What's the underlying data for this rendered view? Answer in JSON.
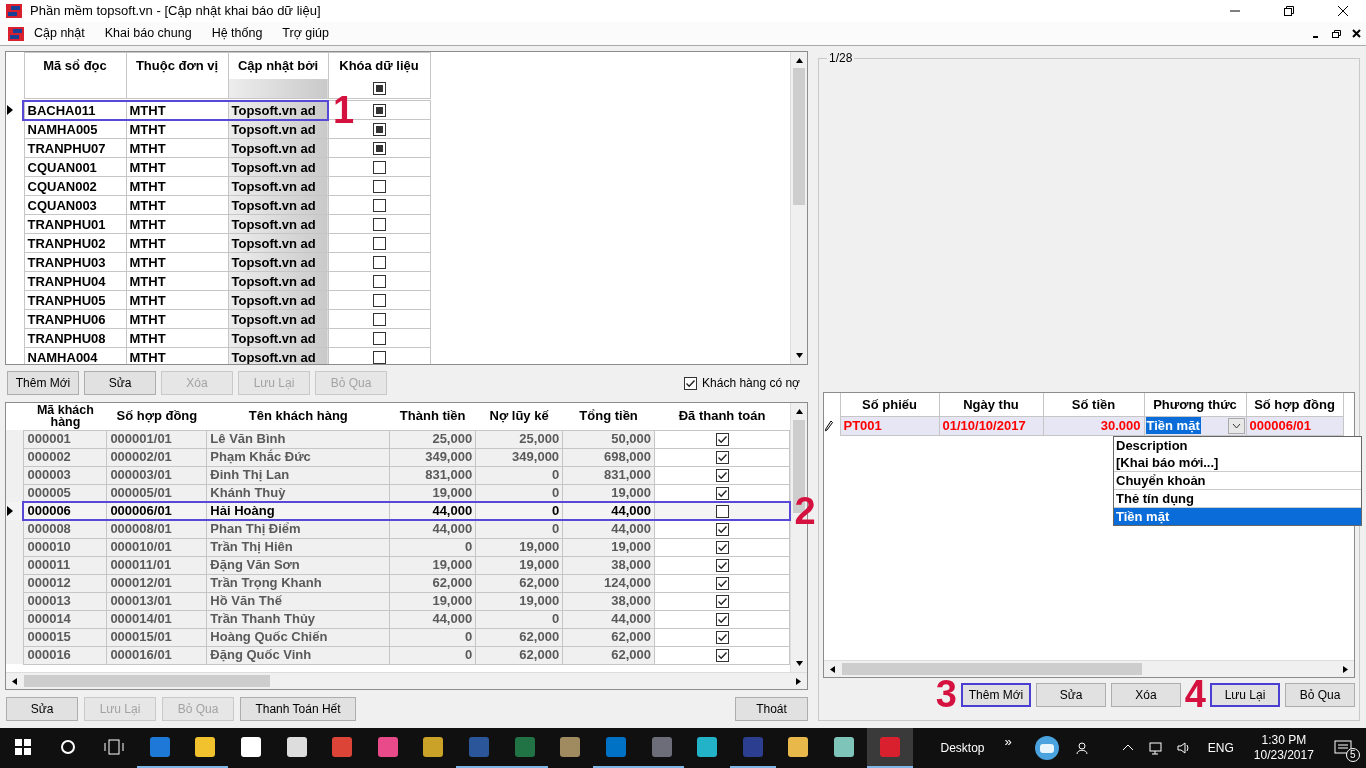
{
  "window": {
    "title": "Phần mềm topsoft.vn - [Cập nhật khai báo dữ liệu]"
  },
  "menu": [
    "Cập nhật",
    "Khai báo chung",
    "Hệ thống",
    "Trợ giúp"
  ],
  "reader_grid": {
    "columns": [
      "Mã sổ đọc",
      "Thuộc đơn vị",
      "Cập nhật bởi",
      "Khóa dữ liệu"
    ],
    "header_lock_checked": true,
    "rows": [
      {
        "code": "BACHA011",
        "unit": "MTHT",
        "updated_by": "Topsoft.vn ad",
        "locked": true,
        "current": true,
        "callout": "1"
      },
      {
        "code": "NAMHA005",
        "unit": "MTHT",
        "updated_by": "Topsoft.vn ad",
        "locked": true,
        "current": false
      },
      {
        "code": "TRANPHU07",
        "unit": "MTHT",
        "updated_by": "Topsoft.vn ad",
        "locked": true,
        "current": false
      },
      {
        "code": "CQUAN001",
        "unit": "MTHT",
        "updated_by": "Topsoft.vn ad",
        "locked": false,
        "current": false
      },
      {
        "code": "CQUAN002",
        "unit": "MTHT",
        "updated_by": "Topsoft.vn ad",
        "locked": false,
        "current": false
      },
      {
        "code": "CQUAN003",
        "unit": "MTHT",
        "updated_by": "Topsoft.vn ad",
        "locked": false,
        "current": false
      },
      {
        "code": "TRANPHU01",
        "unit": "MTHT",
        "updated_by": "Topsoft.vn ad",
        "locked": false,
        "current": false
      },
      {
        "code": "TRANPHU02",
        "unit": "MTHT",
        "updated_by": "Topsoft.vn ad",
        "locked": false,
        "current": false
      },
      {
        "code": "TRANPHU03",
        "unit": "MTHT",
        "updated_by": "Topsoft.vn ad",
        "locked": false,
        "current": false
      },
      {
        "code": "TRANPHU04",
        "unit": "MTHT",
        "updated_by": "Topsoft.vn ad",
        "locked": false,
        "current": false
      },
      {
        "code": "TRANPHU05",
        "unit": "MTHT",
        "updated_by": "Topsoft.vn ad",
        "locked": false,
        "current": false
      },
      {
        "code": "TRANPHU06",
        "unit": "MTHT",
        "updated_by": "Topsoft.vn ad",
        "locked": false,
        "current": false
      },
      {
        "code": "TRANPHU08",
        "unit": "MTHT",
        "updated_by": "Topsoft.vn ad",
        "locked": false,
        "current": false
      },
      {
        "code": "NAMHA004",
        "unit": "MTHT",
        "updated_by": "Topsoft.vn ad",
        "locked": false,
        "current": false
      }
    ]
  },
  "top_buttons": [
    {
      "label": "Thêm Mới",
      "disabled": false
    },
    {
      "label": "Sửa",
      "disabled": false
    },
    {
      "label": "Xóa",
      "disabled": true
    },
    {
      "label": "Lưu Lại",
      "disabled": true
    },
    {
      "label": "Bỏ Qua",
      "disabled": true
    }
  ],
  "debt_filter": {
    "label": "Khách hàng có nợ",
    "checked": true
  },
  "customer_grid": {
    "columns": [
      "Mã khách hàng",
      "Số hợp đồng",
      "Tên khách hàng",
      "Thành tiền",
      "Nợ lũy kế",
      "Tổng tiền",
      "Đã thanh toán"
    ],
    "rows": [
      {
        "cells": [
          "000001",
          "000001/01",
          "Lê Văn Bình",
          "25,000",
          "25,000",
          "50,000"
        ],
        "paid": true,
        "current": false
      },
      {
        "cells": [
          "000002",
          "000002/01",
          "Phạm Khắc Đức",
          "349,000",
          "349,000",
          "698,000"
        ],
        "paid": true,
        "current": false
      },
      {
        "cells": [
          "000003",
          "000003/01",
          "Đinh Thị Lan",
          "831,000",
          "0",
          "831,000"
        ],
        "paid": true,
        "current": false
      },
      {
        "cells": [
          "000005",
          "000005/01",
          "Khánh Thuỳ",
          "19,000",
          "0",
          "19,000"
        ],
        "paid": true,
        "current": false
      },
      {
        "cells": [
          "000006",
          "000006/01",
          "Hải Hoàng",
          "44,000",
          "0",
          "44,000"
        ],
        "paid": false,
        "current": true,
        "callout": "2"
      },
      {
        "cells": [
          "000008",
          "000008/01",
          "Phan Thị Điểm",
          "44,000",
          "0",
          "44,000"
        ],
        "paid": true,
        "current": false
      },
      {
        "cells": [
          "000010",
          "000010/01",
          "Trần Thị Hiên",
          "0",
          "19,000",
          "19,000"
        ],
        "paid": true,
        "current": false
      },
      {
        "cells": [
          "000011",
          "000011/01",
          "Đặng Văn Sơn",
          "19,000",
          "19,000",
          "38,000"
        ],
        "paid": true,
        "current": false
      },
      {
        "cells": [
          "000012",
          "000012/01",
          "Trần Trọng Khanh",
          "62,000",
          "62,000",
          "124,000"
        ],
        "paid": true,
        "current": false
      },
      {
        "cells": [
          "000013",
          "000013/01",
          "Hồ Văn Thế",
          "19,000",
          "19,000",
          "38,000"
        ],
        "paid": true,
        "current": false
      },
      {
        "cells": [
          "000014",
          "000014/01",
          "Trần Thanh Thủy",
          "44,000",
          "0",
          "44,000"
        ],
        "paid": true,
        "current": false
      },
      {
        "cells": [
          "000015",
          "000015/01",
          "Hoàng Quốc Chiến",
          "0",
          "62,000",
          "62,000"
        ],
        "paid": true,
        "current": false
      },
      {
        "cells": [
          "000016",
          "000016/01",
          "Đặng Quốc Vinh",
          "0",
          "62,000",
          "62,000"
        ],
        "paid": true,
        "current": false
      }
    ]
  },
  "bottom_buttons": [
    {
      "label": "Sửa",
      "disabled": false
    },
    {
      "label": "Lưu Lại",
      "disabled": true
    },
    {
      "label": "Bỏ Qua",
      "disabled": true
    },
    {
      "label": "Thanh Toán Hết",
      "disabled": false
    }
  ],
  "exit_button": "Thoát",
  "receipt_panel": {
    "record_counter": "1/28",
    "columns": [
      "Số phiếu",
      "Ngày thu",
      "Số tiền",
      "Phương thức",
      "Số hợp đồng"
    ],
    "rows": [
      {
        "number": "PT001",
        "date": "01/10/10/2017",
        "amount": "30.000",
        "method": "Tiền mặt",
        "contract": "000006/01",
        "editing": true
      }
    ],
    "method_dropdown": {
      "header": "Description",
      "options": [
        {
          "label": "[Khai báo mới...]",
          "selected": false
        },
        {
          "label": "Chuyển khoản",
          "selected": false
        },
        {
          "label": "Thẻ tín dụng",
          "selected": false
        },
        {
          "label": "Tiền mặt",
          "selected": true
        }
      ]
    },
    "buttons": [
      {
        "label": "Thêm Mới",
        "callout": "3"
      },
      {
        "label": "Sửa"
      },
      {
        "label": "Xóa"
      },
      {
        "label": "Lưu Lại",
        "callout": "4"
      },
      {
        "label": "Bỏ Qua"
      }
    ]
  },
  "taskbar": {
    "apps": [
      {
        "color": "#1e78d7",
        "open": true,
        "selected": false
      },
      {
        "color": "#f2c12e",
        "open": true,
        "selected": false
      },
      {
        "color": "#ffffff",
        "open": false,
        "selected": false
      },
      {
        "color": "#dddddd",
        "open": false,
        "selected": false
      },
      {
        "color": "#db4437",
        "open": false,
        "selected": false
      },
      {
        "color": "#e84a8a",
        "open": false,
        "selected": false
      },
      {
        "color": "#c9a227",
        "open": false,
        "selected": false
      },
      {
        "color": "#2b579a",
        "open": true,
        "selected": false
      },
      {
        "color": "#217346",
        "open": true,
        "selected": false
      },
      {
        "color": "#a08a60",
        "open": false,
        "selected": false
      },
      {
        "color": "#0072c6",
        "open": true,
        "selected": false
      },
      {
        "color": "#6d6d7a",
        "open": true,
        "selected": false
      },
      {
        "color": "#22b3c9",
        "open": false,
        "selected": false
      },
      {
        "color": "#2c3e8f",
        "open": true,
        "selected": false
      },
      {
        "color": "#e8b84a",
        "open": false,
        "selected": false
      },
      {
        "color": "#7fc4b8",
        "open": false,
        "selected": false
      },
      {
        "color": "#d8202f",
        "open": true,
        "selected": true
      }
    ],
    "desktop_label": "Desktop",
    "overflow": "»",
    "language": "ENG",
    "time": "1:30 PM",
    "date": "10/23/2017",
    "notification_count": "5"
  }
}
